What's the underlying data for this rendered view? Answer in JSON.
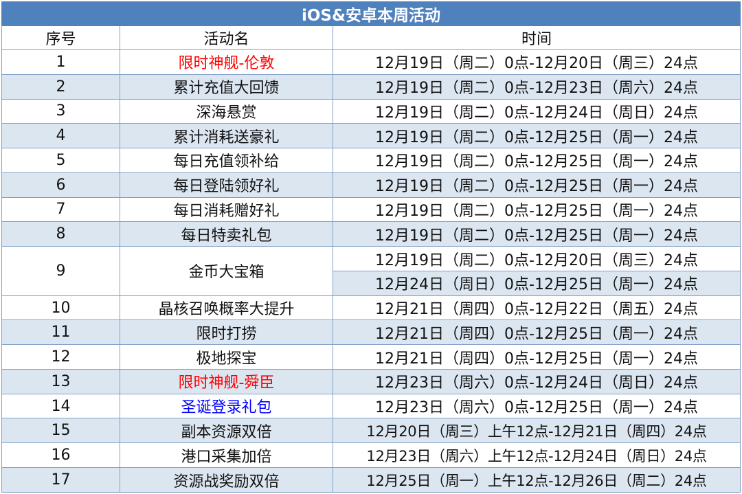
{
  "title": "iOS&安卓本周活动",
  "headers": {
    "index": "序号",
    "name": "活动名",
    "time": "时间"
  },
  "colors": {
    "header_bg": "#4f81bd",
    "band_bg": "#dce6f1",
    "highlight_red": "#ff0000",
    "highlight_blue": "#0000ff",
    "grid": "#7f9fc7"
  },
  "rows": [
    {
      "index": "1",
      "name": "限时神舰-伦敦",
      "times": [
        "12月19日（周二）0点-12月20日（周三）24点"
      ],
      "highlight": "red"
    },
    {
      "index": "2",
      "name": "累计充值大回馈",
      "times": [
        "12月19日（周二）0点-12月23日（周六）24点"
      ]
    },
    {
      "index": "3",
      "name": "深海悬赏",
      "times": [
        "12月19日（周二）0点-12月24日（周日）24点"
      ]
    },
    {
      "index": "4",
      "name": "累计消耗送豪礼",
      "times": [
        "12月19日（周二）0点-12月25日（周一）24点"
      ]
    },
    {
      "index": "5",
      "name": "每日充值领补给",
      "times": [
        "12月19日（周二）0点-12月25日（周一）24点"
      ]
    },
    {
      "index": "6",
      "name": "每日登陆领好礼",
      "times": [
        "12月19日（周二）0点-12月25日（周一）24点"
      ]
    },
    {
      "index": "7",
      "name": "每日消耗赠好礼",
      "times": [
        "12月19日（周二）0点-12月25日（周一）24点"
      ]
    },
    {
      "index": "8",
      "name": "每日特卖礼包",
      "times": [
        "12月19日（周二）0点-12月25日（周一）24点"
      ]
    },
    {
      "index": "9",
      "name": "金币大宝箱",
      "times": [
        "12月19日（周二）0点-12月20日（周三）24点",
        "12月24日（周日）0点-12月25日（周一）24点"
      ]
    },
    {
      "index": "10",
      "name": "晶核召唤概率大提升",
      "times": [
        "12月21日（周四）0点-12月22日（周五）24点"
      ]
    },
    {
      "index": "11",
      "name": "限时打捞",
      "times": [
        "12月21日（周四）0点-12月25日（周一）24点"
      ]
    },
    {
      "index": "12",
      "name": "极地探宝",
      "times": [
        "12月21日（周四）0点-12月25日（周一）24点"
      ]
    },
    {
      "index": "13",
      "name": "限时神舰-舜臣",
      "times": [
        "12月23日（周六）0点-12月24日（周日）24点"
      ],
      "highlight": "red"
    },
    {
      "index": "14",
      "name": "圣诞登录礼包",
      "times": [
        "12月23日（周六）0点-12月25日（周一）24点"
      ],
      "highlight": "blue"
    },
    {
      "index": "15",
      "name": "副本资源双倍",
      "times": [
        "12月20日（周三）上午12点-12月21日（周四）24点"
      ]
    },
    {
      "index": "16",
      "name": "港口采集加倍",
      "times": [
        "12月23日（周六）上午12点-12月24日（周日）24点"
      ]
    },
    {
      "index": "17",
      "name": "资源战奖励双倍",
      "times": [
        "12月25日（周一）上午12点-12月26日（周二）24点"
      ]
    }
  ]
}
